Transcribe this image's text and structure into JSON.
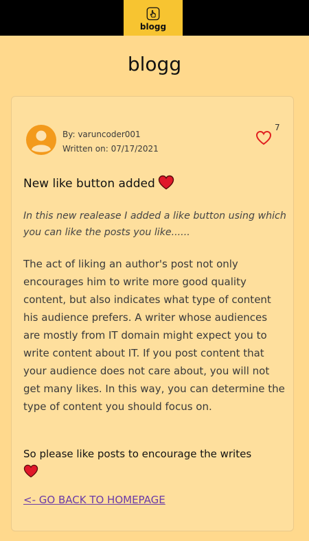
{
  "header": {
    "logo_text": "blogg"
  },
  "page": {
    "title": "blogg"
  },
  "post": {
    "author_line": "By: varuncoder001",
    "date_line": "Written on: 07/17/2021",
    "like_count": "7",
    "title": "New like button added",
    "intro": "In this new realease I added a like button using which you can like the posts you like......",
    "body": "The act of liking an author's post not only encourages him to write more good quality content, but also indicates what type of content his audience prefers. A writer whose audiences are mostly from IT domain might expect you to write content about IT. If you post content that your audience does not care about, you will not get many likes. In this way, you can determine the type of content you should focus on.",
    "cta": "So please like posts to encourage the writes",
    "back_link": "<- GO BACK TO HOMEPAGE"
  },
  "colors": {
    "page_background": "#ffd98d",
    "top_bar": "#000000",
    "logo_background": "#f7c431",
    "card_background": "#fedf9d",
    "avatar": "#f39a1c",
    "heart_outline": "#e02020",
    "heart_fill": "#e0182a",
    "link": "#6a3aa8"
  },
  "icons": {
    "logo": "hand-pointer-icon",
    "avatar": "user-avatar-icon",
    "like": "heart-outline-icon",
    "title_heart": "heart-filled-icon",
    "cta_heart": "heart-filled-icon"
  }
}
